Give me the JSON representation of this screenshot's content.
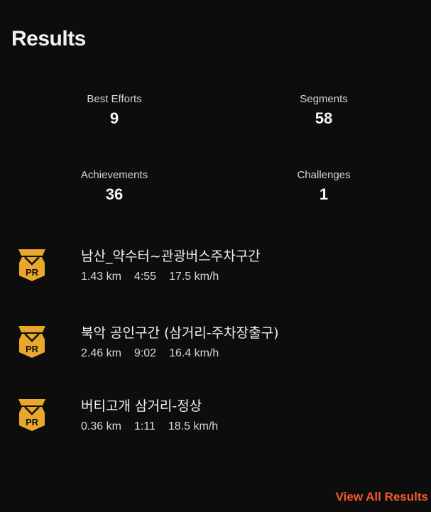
{
  "header": {
    "title": "Results"
  },
  "stats": [
    {
      "label": "Best Efforts",
      "value": "9"
    },
    {
      "label": "Segments",
      "value": "58"
    },
    {
      "label": "Achievements",
      "value": "36"
    },
    {
      "label": "Challenges",
      "value": "1"
    }
  ],
  "segments": [
    {
      "badge": "PR",
      "name": "남산_약수터~관광버스주차구간",
      "distance": "1.43 km",
      "time": "4:55",
      "speed": "17.5 km/h"
    },
    {
      "badge": "PR",
      "name": "북악 공인구간 (삼거리-주차장출구)",
      "distance": "2.46 km",
      "time": "9:02",
      "speed": "16.4 km/h"
    },
    {
      "badge": "PR",
      "name": "버티고개 삼거리-정상",
      "distance": "0.36 km",
      "time": "1:11",
      "speed": "18.5 km/h"
    }
  ],
  "footer": {
    "view_all": "View All Results"
  },
  "colors": {
    "accent": "#f05a2a",
    "badge": "#e9a72b",
    "background": "#0d0d0d"
  },
  "icons": {
    "badge_icon": "pr-medal-icon"
  }
}
